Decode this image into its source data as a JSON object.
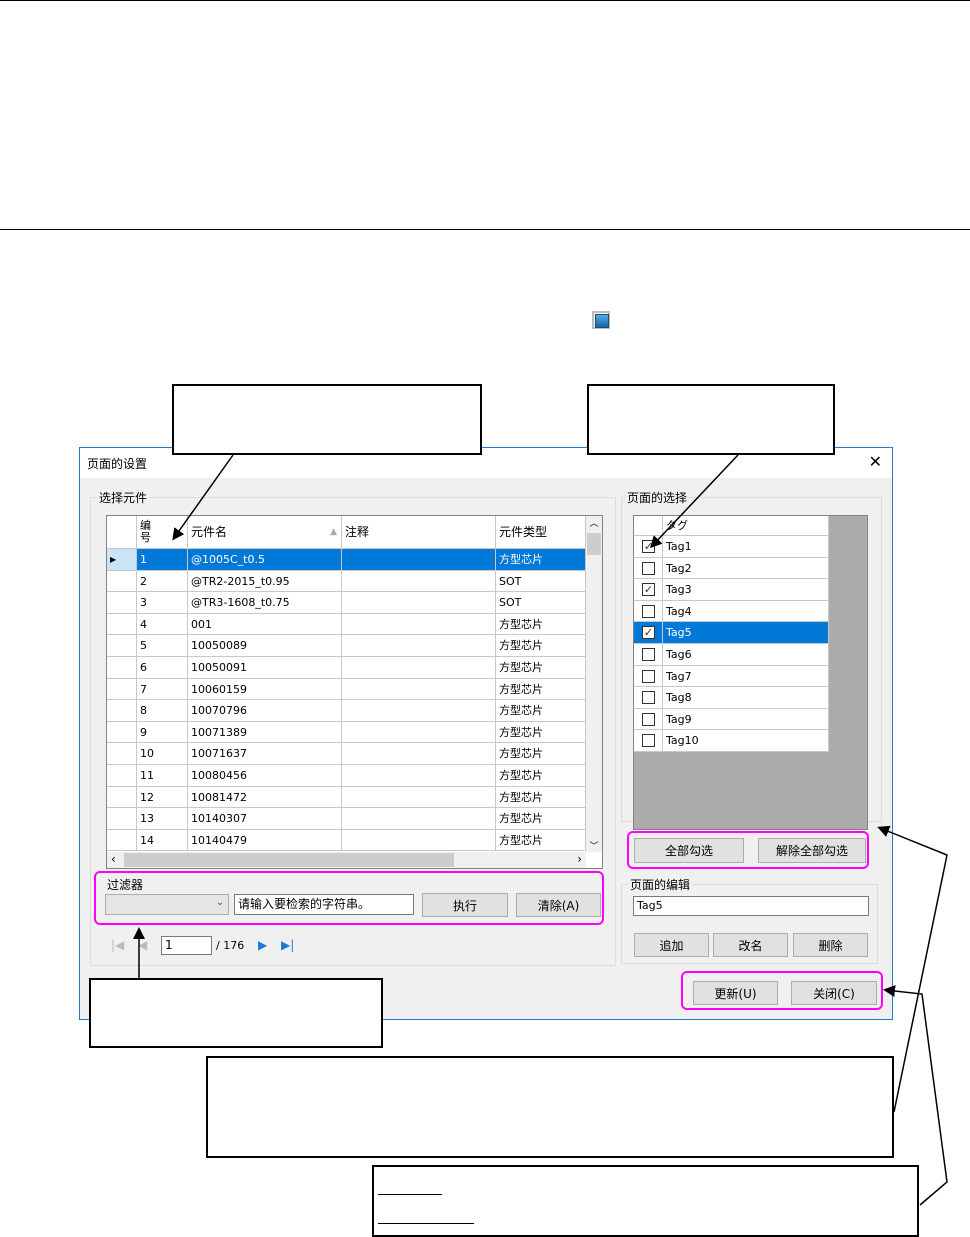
{
  "dialog": {
    "title": "页面的设置",
    "close": "✕"
  },
  "parts": {
    "group_label": "选择元件",
    "columns": [
      "编号",
      "元件名",
      "注释",
      "元件类型"
    ],
    "rows": [
      {
        "no": "1",
        "name": "@1005C_t0.5",
        "note": "",
        "type": "方型芯片"
      },
      {
        "no": "2",
        "name": "@TR2-2015_t0.95",
        "note": "",
        "type": "SOT"
      },
      {
        "no": "3",
        "name": "@TR3-1608_t0.75",
        "note": "",
        "type": "SOT"
      },
      {
        "no": "4",
        "name": "001",
        "note": "",
        "type": "方型芯片"
      },
      {
        "no": "5",
        "name": "10050089",
        "note": "",
        "type": "方型芯片"
      },
      {
        "no": "6",
        "name": "10050091",
        "note": "",
        "type": "方型芯片"
      },
      {
        "no": "7",
        "name": "10060159",
        "note": "",
        "type": "方型芯片"
      },
      {
        "no": "8",
        "name": "10070796",
        "note": "",
        "type": "方型芯片"
      },
      {
        "no": "9",
        "name": "10071389",
        "note": "",
        "type": "方型芯片"
      },
      {
        "no": "10",
        "name": "10071637",
        "note": "",
        "type": "方型芯片"
      },
      {
        "no": "11",
        "name": "10080456",
        "note": "",
        "type": "方型芯片"
      },
      {
        "no": "12",
        "name": "10081472",
        "note": "",
        "type": "方型芯片"
      },
      {
        "no": "13",
        "name": "10140307",
        "note": "",
        "type": "方型芯片"
      },
      {
        "no": "14",
        "name": "10140479",
        "note": "",
        "type": "方型芯片"
      }
    ]
  },
  "filter": {
    "label": "过滤器",
    "placeholder": "请输入要检索的字符串。",
    "execute": "执行",
    "clear": "清除(A)"
  },
  "pager": {
    "current": "1",
    "total": "/ 176"
  },
  "tags": {
    "group_label": "页面的选择",
    "header": "タグ",
    "items": [
      {
        "label": "Tag1",
        "checked": true
      },
      {
        "label": "Tag2",
        "checked": false
      },
      {
        "label": "Tag3",
        "checked": true
      },
      {
        "label": "Tag4",
        "checked": false
      },
      {
        "label": "Tag5",
        "checked": true
      },
      {
        "label": "Tag6",
        "checked": false
      },
      {
        "label": "Tag7",
        "checked": false
      },
      {
        "label": "Tag8",
        "checked": false
      },
      {
        "label": "Tag9",
        "checked": false
      },
      {
        "label": "Tag10",
        "checked": false
      }
    ],
    "select_all": "全部勾选",
    "deselect_all": "解除全部勾选"
  },
  "edit": {
    "group_label": "页面的编辑",
    "value": "Tag5",
    "add": "追加",
    "rename": "改名",
    "delete": "删除"
  },
  "footer": {
    "update": "更新(U)",
    "close": "关闭(C)"
  }
}
